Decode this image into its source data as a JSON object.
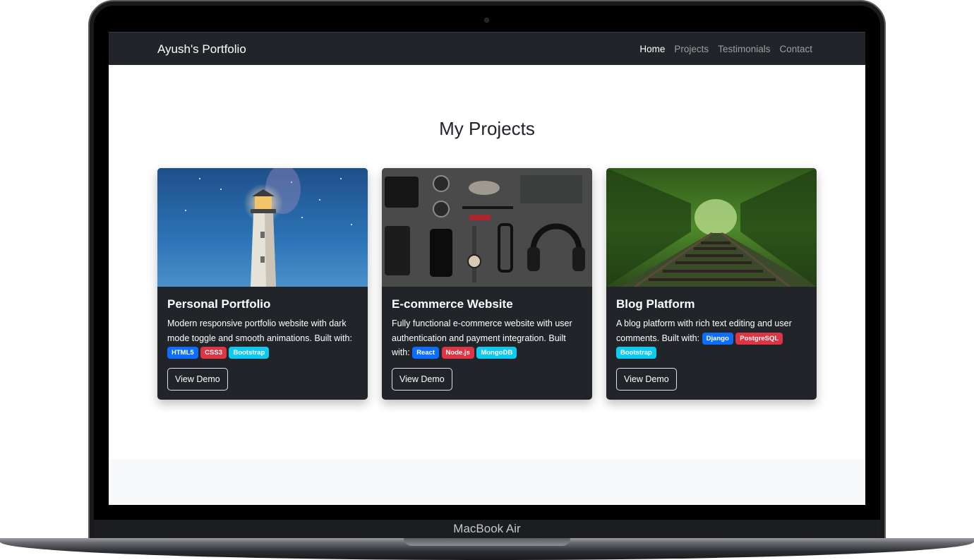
{
  "device": {
    "label": "MacBook Air"
  },
  "navbar": {
    "brand": "Ayush's Portfolio",
    "links": [
      {
        "label": "Home",
        "active": true
      },
      {
        "label": "Projects",
        "active": false
      },
      {
        "label": "Testimonials",
        "active": false
      },
      {
        "label": "Contact",
        "active": false
      }
    ]
  },
  "main": {
    "title": "My Projects",
    "projects": [
      {
        "title": "Personal Portfolio",
        "description": "Modern responsive portfolio website with dark mode toggle and smooth animations. Built with:",
        "badges": [
          {
            "label": "HTML5",
            "color": "#0d6efd"
          },
          {
            "label": "CSS3",
            "color": "#dc3545"
          },
          {
            "label": "Bootstrap",
            "color": "#0dcaf0"
          }
        ],
        "button": "View Demo",
        "image": "lighthouse-photo"
      },
      {
        "title": "E-commerce Website",
        "description": "Fully functional e-commerce website with user authentication and payment integration. Built with:",
        "badges": [
          {
            "label": "React",
            "color": "#0d6efd"
          },
          {
            "label": "Node.js",
            "color": "#dc3545"
          },
          {
            "label": "MongoDB",
            "color": "#0dcaf0"
          }
        ],
        "button": "View Demo",
        "image": "accessories-flatlay-photo"
      },
      {
        "title": "Blog Platform",
        "description": "A blog platform with rich text editing and user comments. Built with:",
        "badges": [
          {
            "label": "Django",
            "color": "#0d6efd"
          },
          {
            "label": "PostgreSQL",
            "color": "#dc3545"
          },
          {
            "label": "Bootstrap",
            "color": "#0dcaf0"
          }
        ],
        "button": "View Demo",
        "image": "railway-track-photo"
      }
    ]
  },
  "colors": {
    "navbar_bg": "#212529",
    "card_bg": "#212529",
    "footer_bg": "#f8f9fa"
  }
}
